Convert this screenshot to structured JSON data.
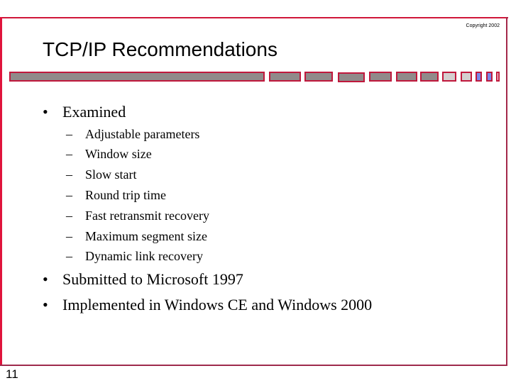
{
  "slide": {
    "copyright": "Copyright 2002",
    "title": "TCP/IP Recommendations",
    "slide_number": "11",
    "colors": {
      "frame": "#d0173a",
      "frame_dark": "#9e2a4c",
      "bar_fill": "#908a8a",
      "bar_fill_light": "#d4cfcf",
      "bar_fill_blue": "#7a86e8",
      "bar_border": "#c0183c"
    }
  },
  "bullets": [
    {
      "symbol": "•",
      "text": "Examined",
      "sub": [
        {
          "symbol": "–",
          "text": "Adjustable parameters"
        },
        {
          "symbol": "–",
          "text": "Window size"
        },
        {
          "symbol": "–",
          "text": "Slow start"
        },
        {
          "symbol": "–",
          "text": "Round trip time"
        },
        {
          "symbol": "–",
          "text": "Fast retransmit recovery"
        },
        {
          "symbol": "–",
          "text": "Maximum segment size"
        },
        {
          "symbol": "–",
          "text": "Dynamic link recovery"
        }
      ]
    },
    {
      "symbol": "•",
      "text": "Submitted to Microsoft 1997",
      "sub": []
    },
    {
      "symbol": "•",
      "text": "Implemented in Windows CE and Windows 2000",
      "sub": []
    }
  ]
}
